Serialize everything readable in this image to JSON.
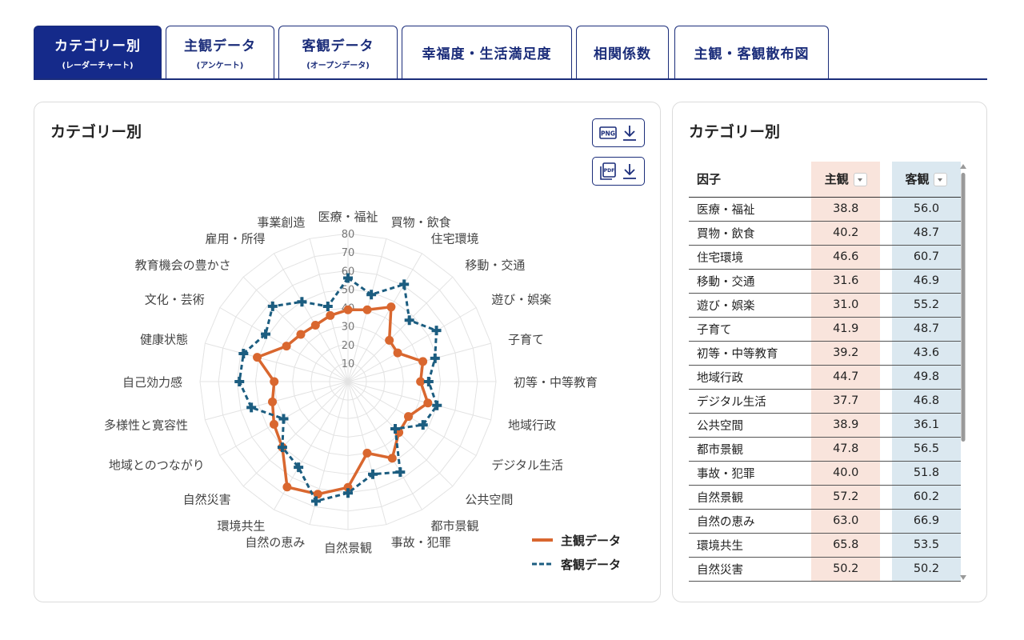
{
  "tabs": [
    {
      "label": "カテゴリー別",
      "sub": "(レーダーチャート)",
      "active": true
    },
    {
      "label": "主観データ",
      "sub": "(アンケート)"
    },
    {
      "label": "客観データ",
      "sub": "(オープンデータ)"
    },
    {
      "label": "幸福度・生活満足度"
    },
    {
      "label": "相関係数"
    },
    {
      "label": "主観・客観散布図"
    }
  ],
  "chart_panel": {
    "title": "カテゴリー別",
    "png_label": "PNG",
    "pdf_label": "PDF"
  },
  "table_panel": {
    "title": "カテゴリー別",
    "headers": {
      "factor": "因子",
      "subjective": "主観",
      "objective": "客観"
    }
  },
  "colors": {
    "subjective": "#d9672f",
    "objective": "#1c5d80",
    "tab_active": "#152a8a"
  },
  "chart_data": {
    "type": "radar",
    "categories": [
      "医療・福祉",
      "買物・飲食",
      "住宅環境",
      "移動・交通",
      "遊び・娯楽",
      "子育て",
      "初等・中等教育",
      "地域行政",
      "デジタル生活",
      "公共空間",
      "都市景観",
      "事故・犯罪",
      "自然景観",
      "自然の恵み",
      "環境共生",
      "自然災害",
      "地域とのつながり",
      "多様性と寛容性",
      "自己効力感",
      "健康状態",
      "文化・芸術",
      "教育機会の豊かさ",
      "雇用・所得",
      "事業創造"
    ],
    "ticks": [
      "10",
      "20",
      "30",
      "40",
      "50",
      "60",
      "70",
      "80"
    ],
    "rmax": 80,
    "series": [
      {
        "name": "主観データ",
        "values": [
          38.8,
          40.2,
          46.6,
          31.6,
          31.0,
          41.9,
          39.2,
          44.7,
          37.7,
          38.9,
          47.8,
          40.0,
          57.2,
          63.0,
          65.8,
          50.2,
          46.2,
          42.3,
          39.9,
          50.8,
          38.4,
          36.1,
          35.2,
          37.0
        ]
      },
      {
        "name": "客観データ",
        "values": [
          56.0,
          48.7,
          60.7,
          46.9,
          55.2,
          48.7,
          43.6,
          49.8,
          46.8,
          36.1,
          56.5,
          51.8,
          60.2,
          66.9,
          53.5,
          50.2,
          40.2,
          54.1,
          58.7,
          58.5,
          51.4,
          57.6,
          49.8,
          42.1
        ]
      }
    ],
    "table_rows": [
      [
        "医療・福祉",
        "38.8",
        "56.0"
      ],
      [
        "買物・飲食",
        "40.2",
        "48.7"
      ],
      [
        "住宅環境",
        "46.6",
        "60.7"
      ],
      [
        "移動・交通",
        "31.6",
        "46.9"
      ],
      [
        "遊び・娯楽",
        "31.0",
        "55.2"
      ],
      [
        "子育て",
        "41.9",
        "48.7"
      ],
      [
        "初等・中等教育",
        "39.2",
        "43.6"
      ],
      [
        "地域行政",
        "44.7",
        "49.8"
      ],
      [
        "デジタル生活",
        "37.7",
        "46.8"
      ],
      [
        "公共空間",
        "38.9",
        "36.1"
      ],
      [
        "都市景観",
        "47.8",
        "56.5"
      ],
      [
        "事故・犯罪",
        "40.0",
        "51.8"
      ],
      [
        "自然景観",
        "57.2",
        "60.2"
      ],
      [
        "自然の恵み",
        "63.0",
        "66.9"
      ],
      [
        "環境共生",
        "65.8",
        "53.5"
      ],
      [
        "自然災害",
        "50.2",
        "50.2"
      ]
    ]
  }
}
